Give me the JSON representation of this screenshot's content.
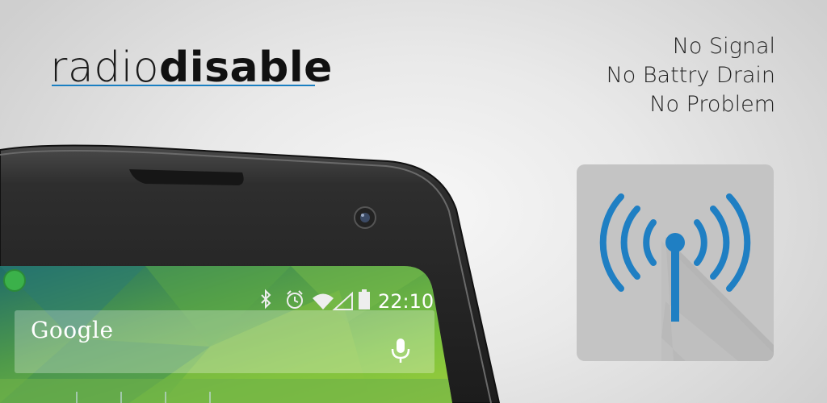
{
  "logo": {
    "light": "radio",
    "bold": "disable"
  },
  "taglines": [
    "No Signal",
    "No Battry Drain",
    "No Problem"
  ],
  "phone": {
    "clock": "22:10",
    "search_label": "Google",
    "status_icons": [
      "bluetooth-icon",
      "alarm-icon",
      "wifi-icon",
      "cell-signal-icon",
      "battery-icon"
    ]
  },
  "app_icon": {
    "name": "antenna-broadcast-icon",
    "accent": "#1f7fc3",
    "tile": "#c4c4c4"
  },
  "colors": {
    "accent": "#1a7fc2",
    "phone_body": "#2a2a2a",
    "screen_green": "#6ab34a"
  }
}
